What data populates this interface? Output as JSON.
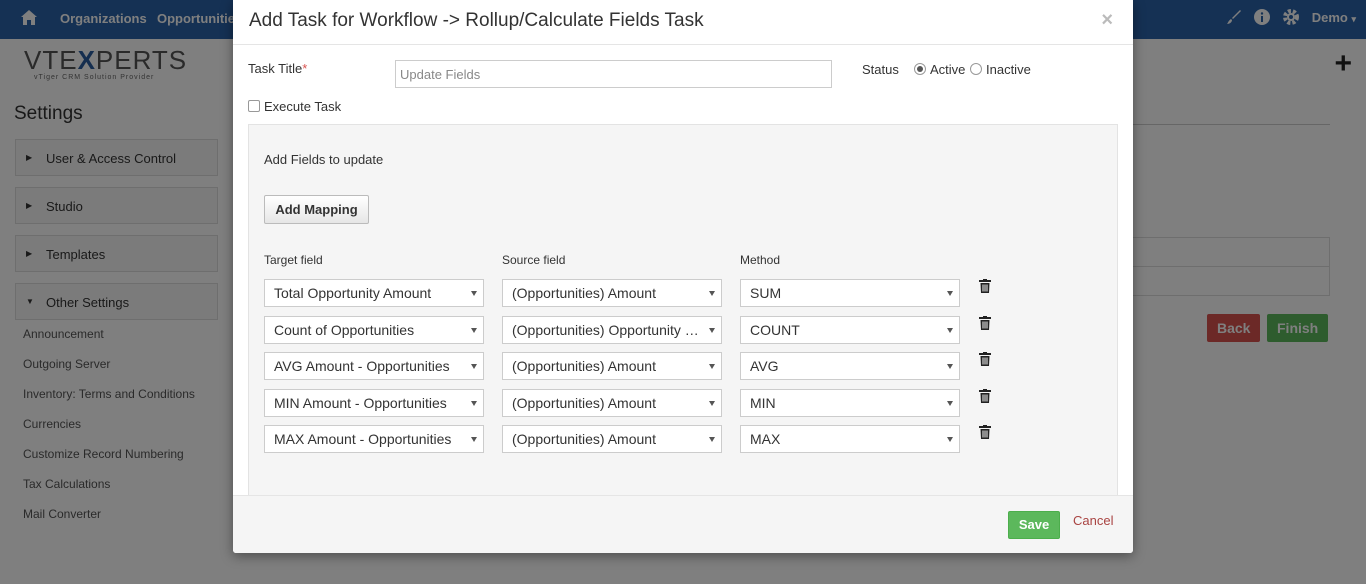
{
  "topbar": {
    "nav_items": [
      "Organizations",
      "Opportunities"
    ],
    "user": "Demo"
  },
  "logo": {
    "brand": "VTEXPERTS",
    "brand_pre": "VTE",
    "brand_x": "X",
    "brand_post": "PERTS",
    "tagline": "vTiger CRM Solution Provider"
  },
  "sidebar": {
    "title": "Settings",
    "sections": [
      "User & Access Control",
      "Studio",
      "Templates",
      "Other Settings"
    ],
    "other_settings_items": [
      "Announcement",
      "Outgoing Server",
      "Inventory: Terms and Conditions",
      "Currencies",
      "Customize Record Numbering",
      "Tax Calculations",
      "Mail Converter"
    ]
  },
  "background_buttons": {
    "back": "Back",
    "finish": "Finish"
  },
  "modal": {
    "title": "Add Task for Workflow -> Rollup/Calculate Fields Task",
    "close": "×",
    "task_title_label": "Task Title",
    "required_mark": "*",
    "task_title_placeholder": "Update Fields",
    "status_label": "Status",
    "status_options": [
      "Active",
      "Inactive"
    ],
    "status_selected": "Active",
    "execute_task_label": "Execute Task",
    "section_title": "Add Fields to update",
    "add_mapping": "Add Mapping",
    "columns": {
      "target": "Target field",
      "source": "Source field",
      "method": "Method"
    },
    "mappings": [
      {
        "target": "Total Opportunity Amount",
        "source": "(Opportunities) Amount",
        "method": "SUM"
      },
      {
        "target": "Count of Opportunities",
        "source": "(Opportunities) Opportunity Name",
        "method": "COUNT"
      },
      {
        "target": "AVG Amount - Opportunities",
        "source": "(Opportunities) Amount",
        "method": "AVG"
      },
      {
        "target": "MIN Amount - Opportunities",
        "source": "(Opportunities) Amount",
        "method": "MIN"
      },
      {
        "target": "MAX Amount - Opportunities",
        "source": "(Opportunities) Amount",
        "method": "MAX"
      }
    ],
    "save": "Save",
    "cancel": "Cancel"
  }
}
